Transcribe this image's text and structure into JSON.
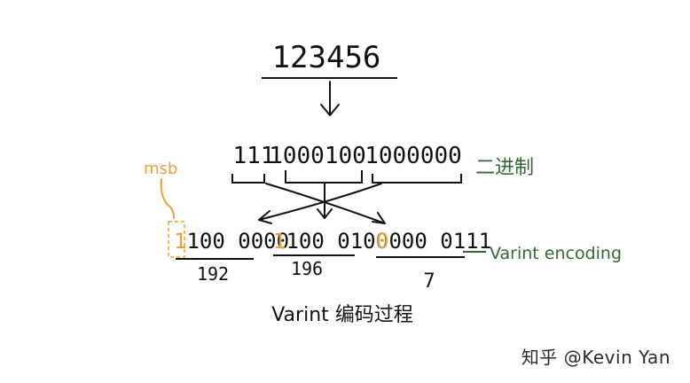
{
  "diagram": {
    "number": "123456",
    "binary_groups": [
      "111",
      "1000100",
      "1000000"
    ],
    "binary_label": "二进制",
    "msb_label": "msb",
    "bytes": [
      {
        "msb": "1",
        "rest": "100 0000",
        "value": "192"
      },
      {
        "msb": "1",
        "rest": "100 0100",
        "value": "196"
      },
      {
        "msb": "0",
        "rest": "000 0111",
        "value": "7"
      }
    ],
    "encoding_label": "Varint encoding",
    "caption": "Varint 编码过程"
  },
  "watermark": "知乎 @Kevin Yan",
  "colors": {
    "ink": "#111111",
    "msb": "#e8a23a",
    "label_green": "#2f6b2f"
  }
}
